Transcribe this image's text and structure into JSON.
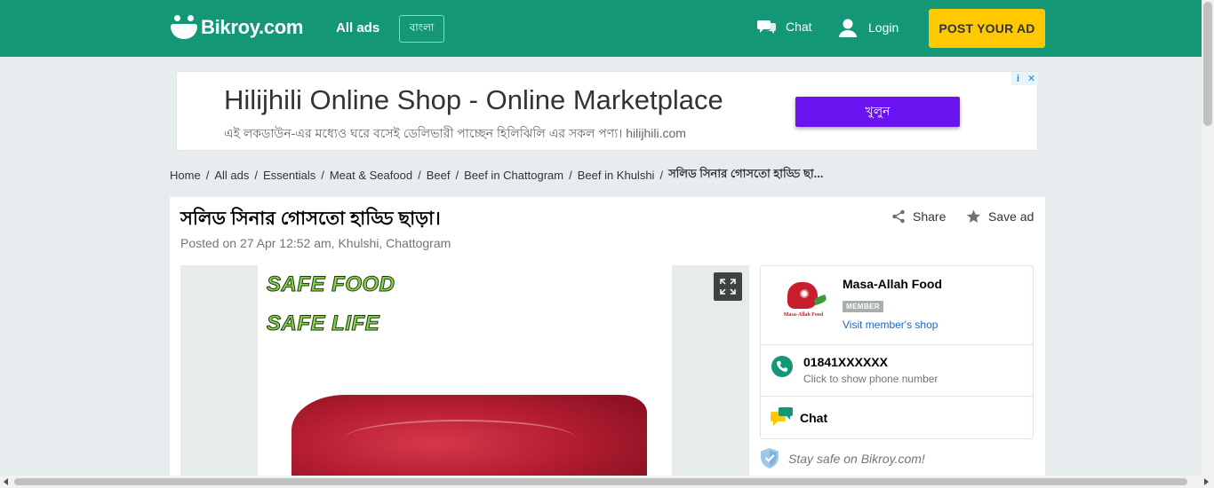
{
  "header": {
    "logo_text": "Bikroy.com",
    "all_ads": "All ads",
    "language_toggle": "বাংলা",
    "chat": "Chat",
    "login": "Login",
    "post_ad": "POST YOUR AD",
    "brand_color": "#149777",
    "post_ad_color": "#ffc800"
  },
  "ad_banner": {
    "title": "Hilijhili Online Shop - Online Marketplace",
    "subtitle": "এই লকডাউন-এর মধ্যেও ঘরে বসেই ডেলিভারী পাচ্ছেন হিলিঝিলি এর সকল পণ্য। hilijhili.com",
    "cta": "খুলুন",
    "info_icon": "i",
    "close_icon": "✕"
  },
  "breadcrumb": {
    "items": [
      "Home",
      "All ads",
      "Essentials",
      "Meat & Seafood",
      "Beef",
      "Beef in Chattogram",
      "Beef in Khulshi"
    ],
    "current": "সলিড সিনার গোসতো হাড্ডি ছা...",
    "separator": "/"
  },
  "listing": {
    "title": "সলিড সিনার গোসতো হাড্ডি ছাড়া।",
    "posted": "Posted on 27 Apr 12:52 am, Khulshi, Chattogram",
    "share": "Share",
    "save": "Save ad",
    "image_text_1": "SAFE FOOD",
    "image_text_2": "SAFE LIFE"
  },
  "seller": {
    "logo_caption": "Masa-Allah Food",
    "name": "Masa-Allah Food",
    "badge": "MEMBER",
    "visit_link": "Visit member's shop",
    "phone": "01841XXXXXX",
    "phone_hint": "Click to show phone number",
    "chat": "Chat",
    "safety": "Stay safe on Bikroy.com!"
  }
}
